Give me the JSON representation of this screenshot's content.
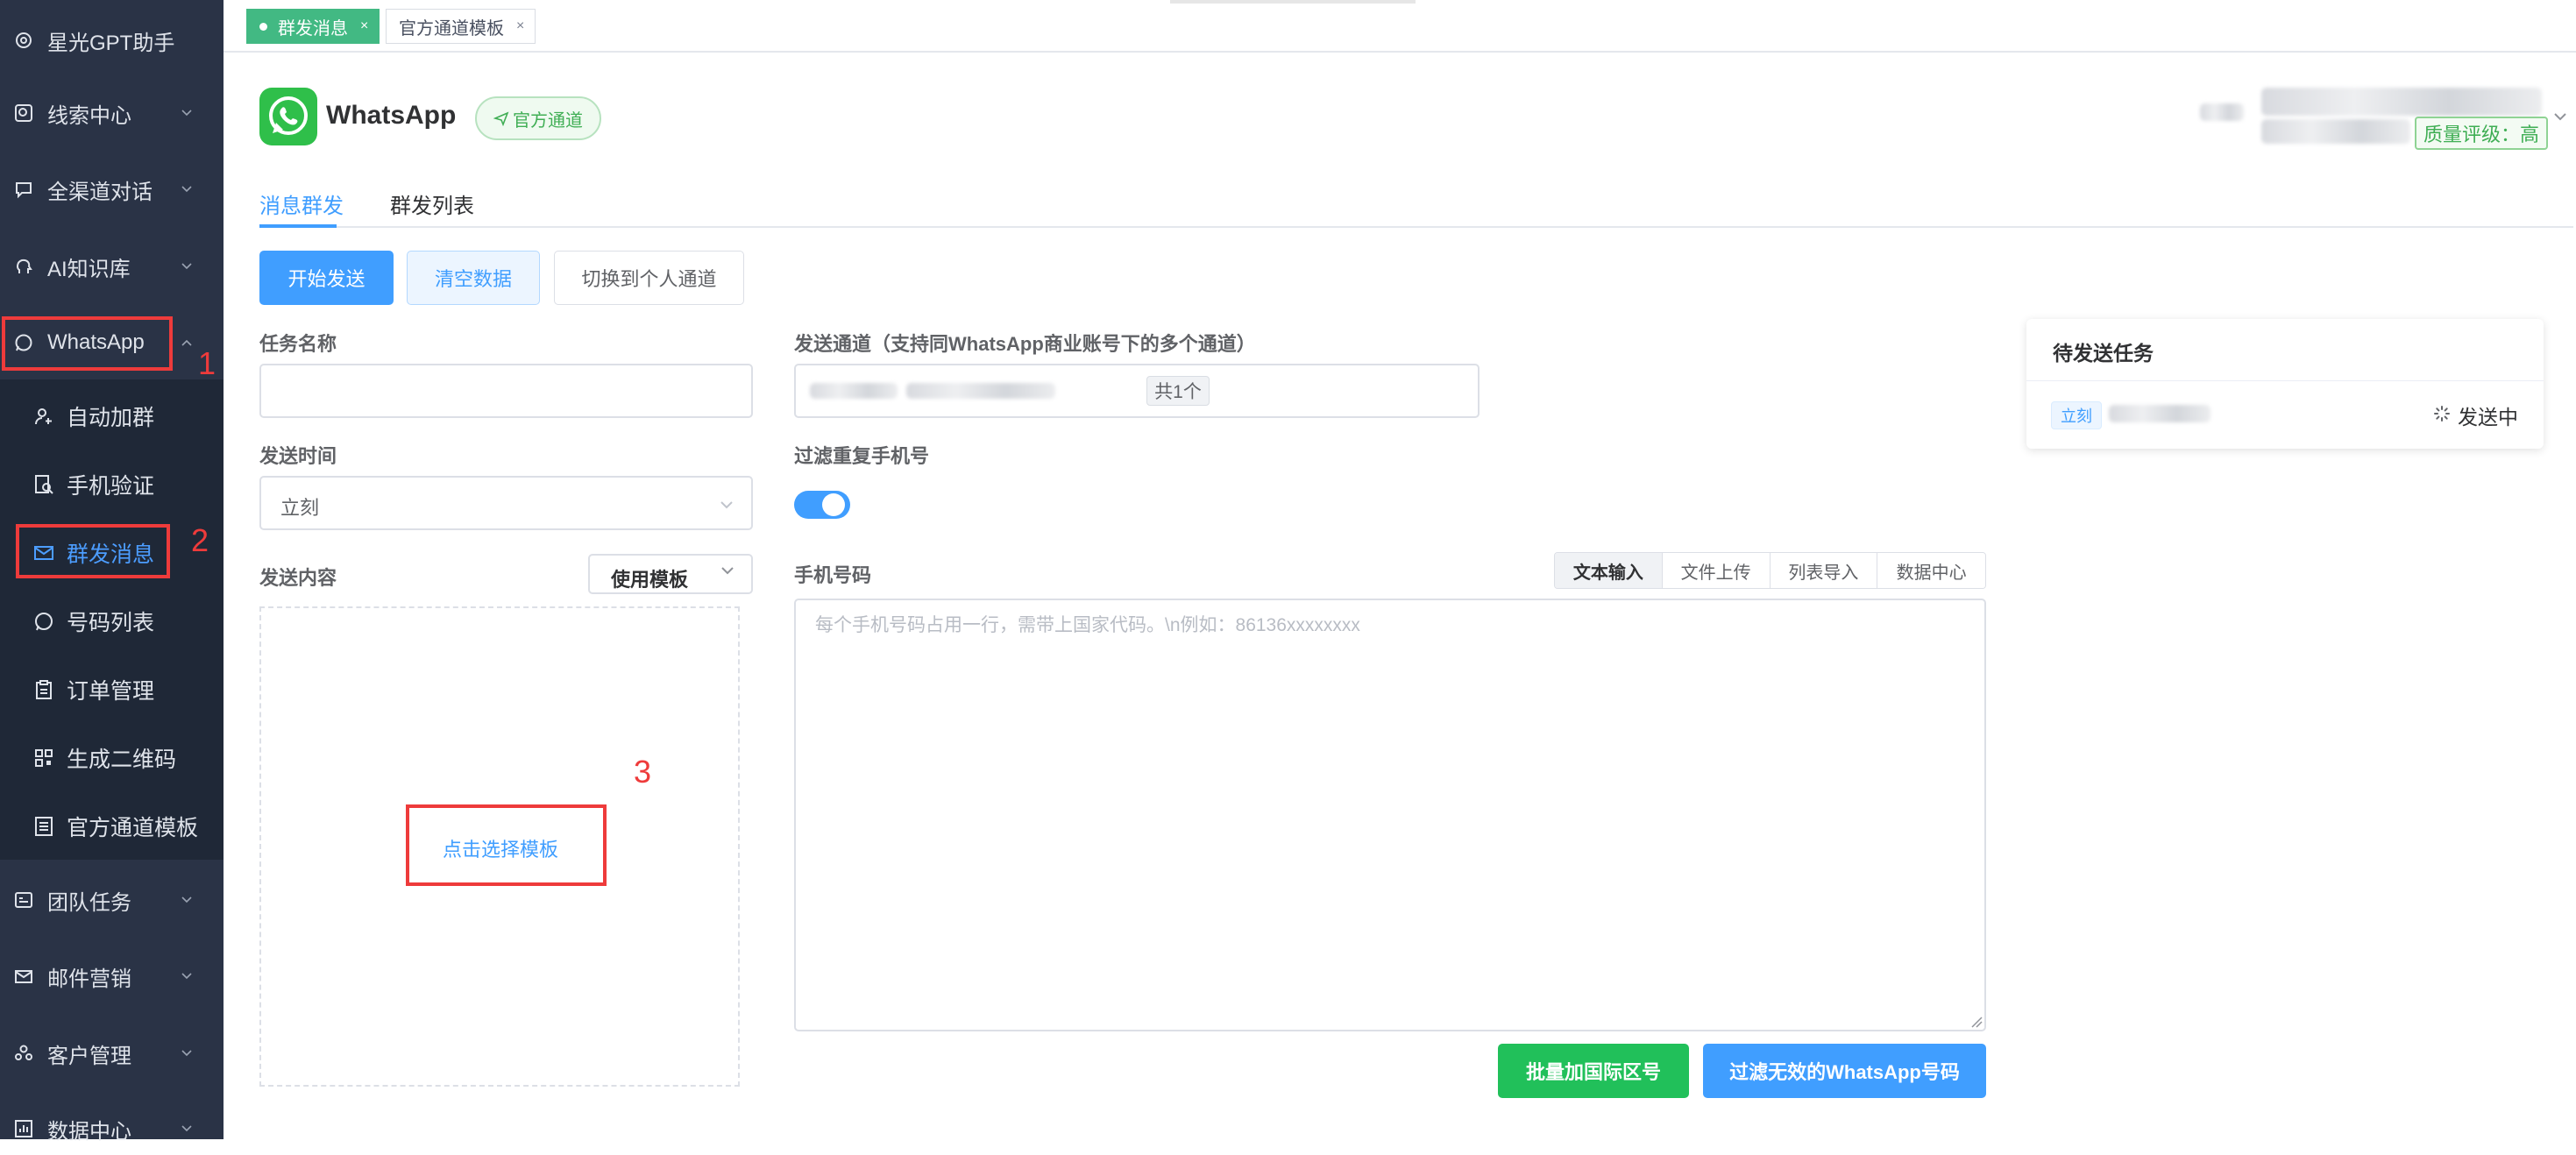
{
  "sidebar": {
    "top": {
      "label": "星光GPT助手"
    },
    "menus": [
      {
        "label": "线索中心"
      },
      {
        "label": "全渠道对话"
      },
      {
        "label": "AI知识库"
      },
      {
        "label": "WhatsApp"
      }
    ],
    "sub": [
      {
        "label": "自动加群"
      },
      {
        "label": "手机验证"
      },
      {
        "label": "群发消息"
      },
      {
        "label": "号码列表"
      },
      {
        "label": "订单管理"
      },
      {
        "label": "生成二维码"
      },
      {
        "label": "官方通道模板"
      }
    ],
    "bottom": [
      {
        "label": "团队任务"
      },
      {
        "label": "邮件营销"
      },
      {
        "label": "客户管理"
      },
      {
        "label": "数据中心"
      }
    ]
  },
  "annotations": {
    "n1": "1",
    "n2": "2",
    "n3": "3"
  },
  "tags": [
    {
      "label": "群发消息",
      "close": "×"
    },
    {
      "label": "官方通道模板",
      "close": "×"
    }
  ],
  "header": {
    "title": "WhatsApp",
    "badge": "官方通道",
    "quality": "质量评级：高"
  },
  "tabs": [
    {
      "label": "消息群发"
    },
    {
      "label": "群发列表"
    }
  ],
  "actions": {
    "start": "开始发送",
    "clear": "清空数据",
    "switch": "切换到个人通道"
  },
  "form": {
    "task_name_label": "任务名称",
    "task_name_value": "",
    "send_time_label": "发送时间",
    "send_time_value": "立刻",
    "content_label": "发送内容",
    "use_template": "使用模板",
    "pick_template": "点击选择模板",
    "channel_label": "发送通道（支持同WhatsApp商业账号下的多个通道）",
    "channel_count": "共1个",
    "filter_label": "过滤重复手机号",
    "filter_on": true,
    "phone_label": "手机号码",
    "phone_placeholder": "每个手机号码占用一行，需带上国家代码。\\n例如：86136xxxxxxxx",
    "phone_tabs": [
      "文本输入",
      "文件上传",
      "列表导入",
      "数据中心"
    ],
    "batch_btn": "批量加国际区号",
    "filter_btn": "过滤无效的WhatsApp号码"
  },
  "pending": {
    "title": "待发送任务",
    "tag": "立刻",
    "status": "发送中"
  },
  "colors": {
    "accent": "#409eff",
    "sidebar": "#2a3346",
    "green": "#21c05a",
    "annotation": "#ee3b3b"
  }
}
